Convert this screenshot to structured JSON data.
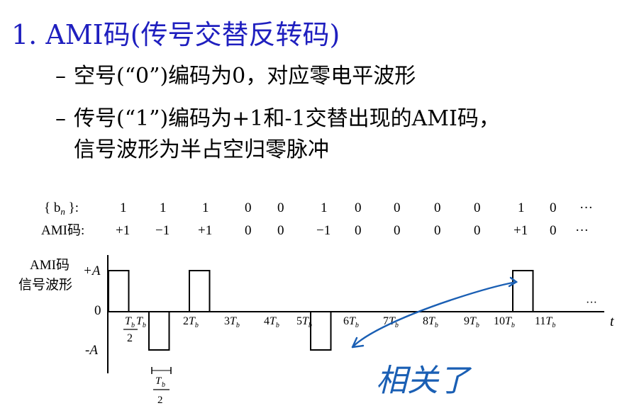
{
  "title": "1. AMI码(传号交替反转码)",
  "bullets": [
    {
      "dash": "–",
      "text": "空号(“0”)编码为0，对应零电平波形"
    },
    {
      "dash": "–",
      "text": "传号(“1”)编码为+1和-1交替出现的AMI码，",
      "cont": "信号波形为半占空归零脉冲"
    }
  ],
  "diagram": {
    "bn_label": "{ b",
    "bn_sub": "n",
    "bn_tail": " }:",
    "ami_label": "AMI码:",
    "bits": [
      "1",
      "1",
      "1",
      "0",
      "0",
      "1",
      "0",
      "0",
      "0",
      "0",
      "1",
      "0",
      "···"
    ],
    "ami": [
      "+1",
      "−1",
      "+1",
      "0",
      "0",
      "−1",
      "0",
      "0",
      "0",
      "0",
      "+1",
      "0",
      "···"
    ],
    "y_title_1": "AMI码",
    "y_title_2": "信号波形",
    "y_ticks": {
      "plus": "+A",
      "zero": "0",
      "minus": "-A"
    },
    "x_ticks": [
      "T_b/2",
      "T_b",
      "2T_b",
      "3T_b",
      "4T_b",
      "5T_b",
      "6T_b",
      "7T_b",
      "8T_b",
      "9T_b",
      "10T_b",
      "11T_b"
    ],
    "axis_end": "t",
    "ellipsis": "···",
    "halfwidth_label": "T_b/2",
    "annotation": "相关了",
    "colors": {
      "title": "#1f1fbf",
      "ink": "#000000",
      "annotation": "#1a5fb4"
    },
    "levels": [
      1,
      -1,
      1,
      0,
      0,
      -1,
      0,
      0,
      0,
      0,
      1,
      0
    ]
  }
}
